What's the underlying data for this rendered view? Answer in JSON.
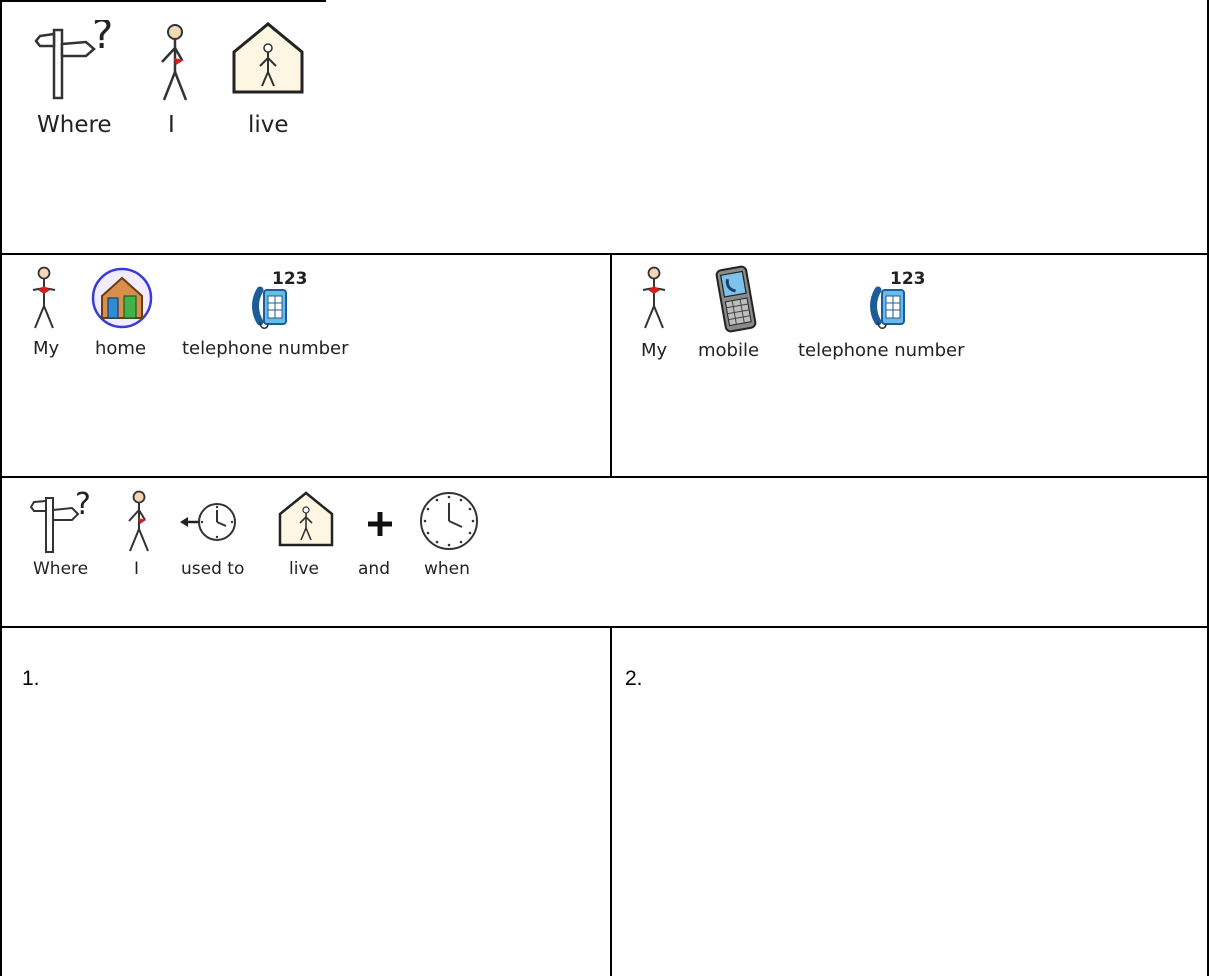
{
  "section_where_i_live": {
    "words": [
      "Where",
      "I",
      "live"
    ]
  },
  "section_home_phone": {
    "words": [
      "My",
      "home",
      "telephone number"
    ],
    "badge": "123"
  },
  "section_mobile_phone": {
    "words": [
      "My",
      "mobile",
      "telephone number"
    ],
    "badge": "123"
  },
  "section_used_to_live": {
    "words": [
      "Where",
      "I",
      "used to",
      "live",
      "and",
      "when"
    ]
  },
  "previous_addresses": {
    "first_label": "1.",
    "second_label": "2."
  },
  "colors": {
    "border": "#000000",
    "house_fill": "#fdf6e3",
    "home_circle": "#3a3adc",
    "phone_blue": "#3c9ad8",
    "red_accent": "#d61e1e"
  }
}
